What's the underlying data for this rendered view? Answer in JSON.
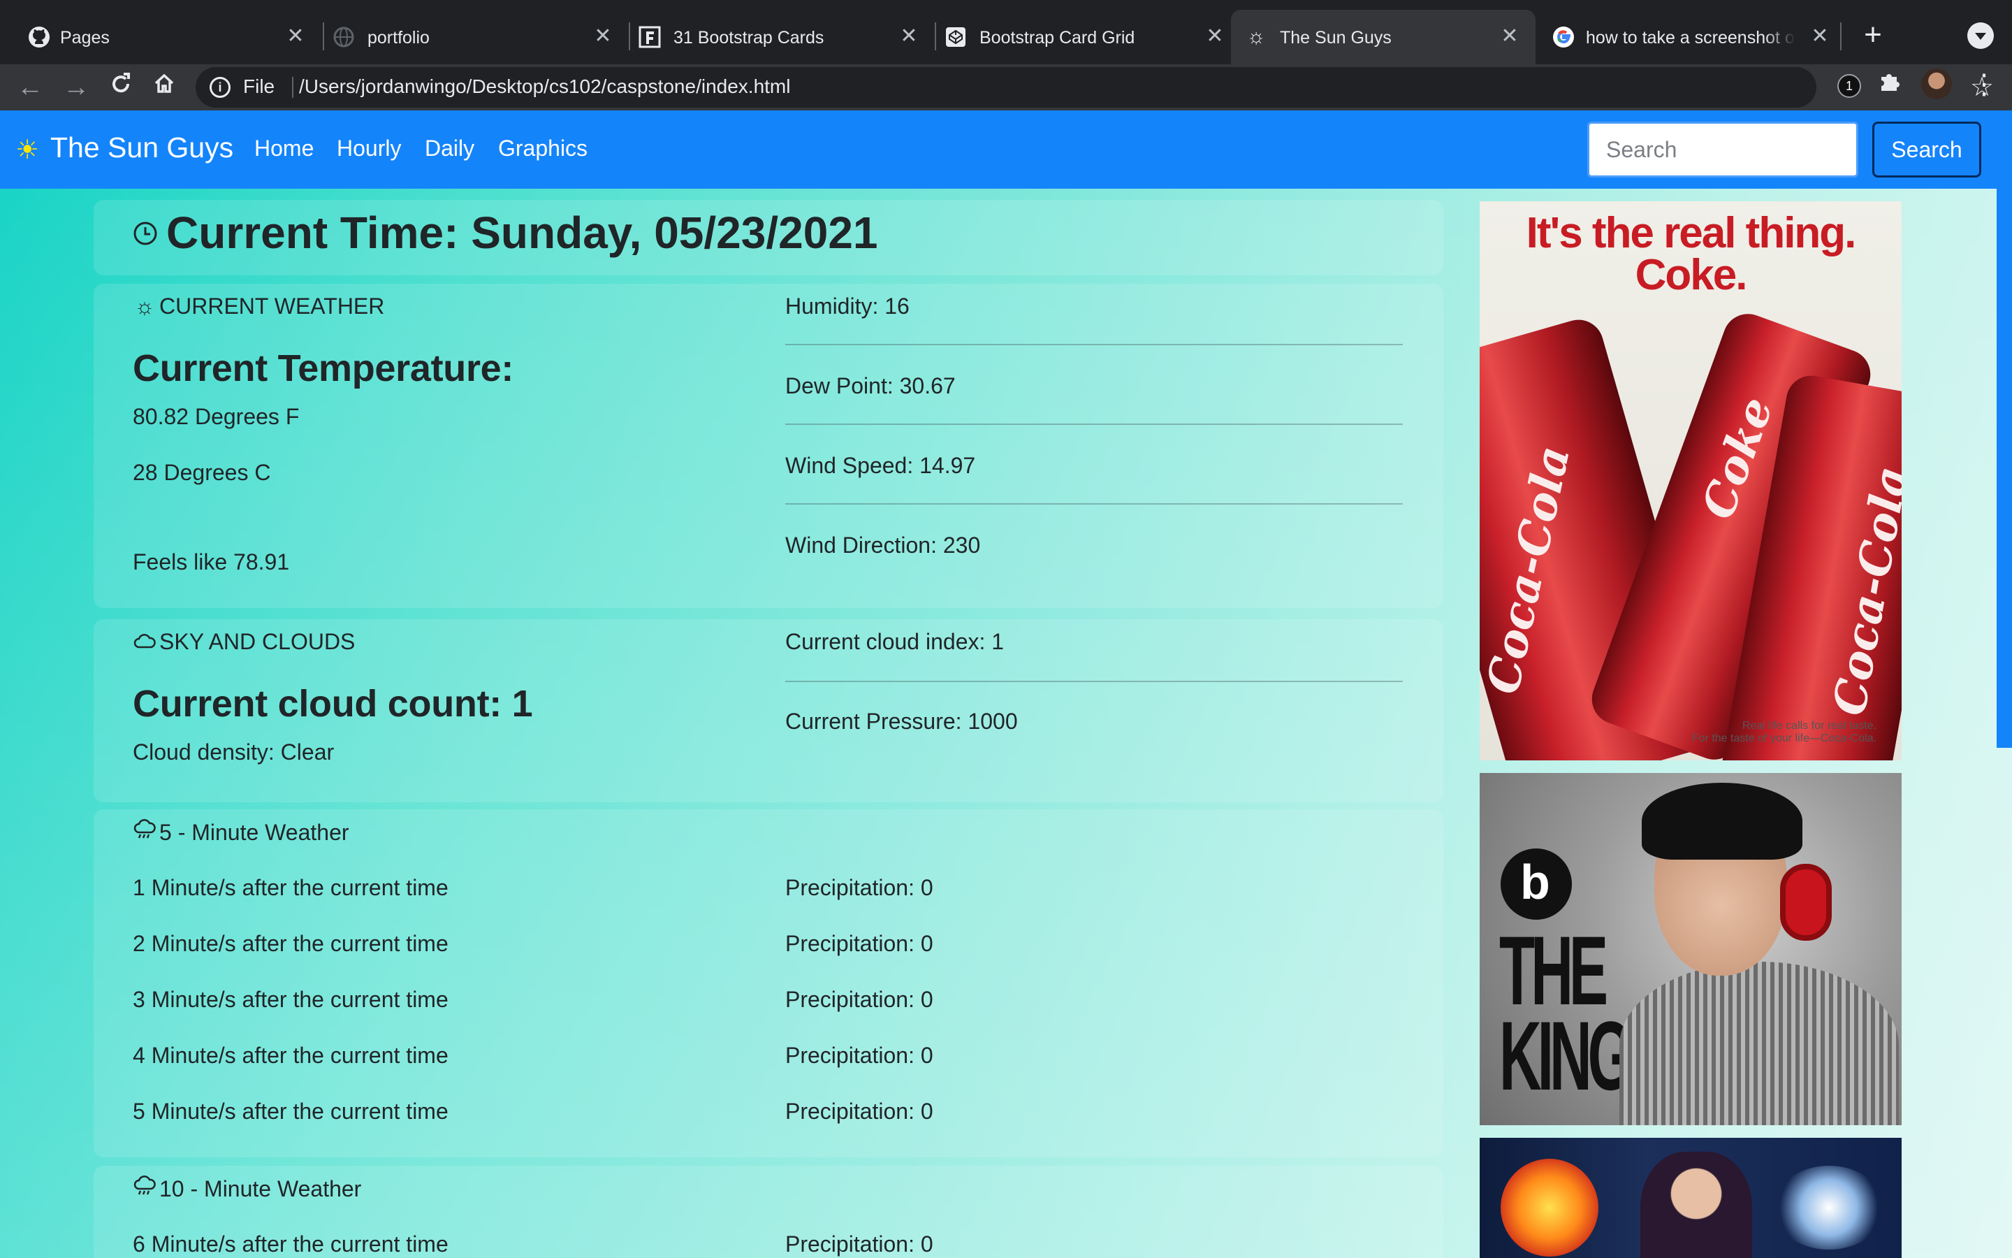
{
  "browser": {
    "tabs": [
      {
        "title": "Pages",
        "icon": "github-icon",
        "active": false
      },
      {
        "title": "portfolio",
        "icon": "globe-icon",
        "active": false
      },
      {
        "title": "31 Bootstrap Cards",
        "icon": "f-icon",
        "active": false
      },
      {
        "title": "Bootstrap Card Grid",
        "icon": "codepen-icon",
        "active": false
      },
      {
        "title": "The Sun Guys",
        "icon": "sun-icon",
        "active": true
      },
      {
        "title": "how to take a screenshot o",
        "icon": "google-icon",
        "active": false
      }
    ],
    "omnibox": {
      "scheme_label": "File",
      "url": "/Users/jordanwingo/Desktop/cs102/caspstone/index.html"
    },
    "extension_badge": "1"
  },
  "navbar": {
    "brand": "The Sun Guys",
    "links": [
      "Home",
      "Hourly",
      "Daily",
      "Graphics"
    ],
    "search_placeholder": "Search",
    "search_button": "Search",
    "colors": {
      "navbar": "#1484fb",
      "brand_icon": "#ffe500"
    }
  },
  "time_card": {
    "title": "Current Time: Sunday, 05/23/2021"
  },
  "weather_card": {
    "heading": "CURRENT WEATHER",
    "temp_heading": "Current Temperature:",
    "temp_f": "80.82 Degrees F",
    "temp_c": "28 Degrees C",
    "feels_like": "Feels like 78.91",
    "humidity": "Humidity: 16",
    "dew_point": "Dew Point: 30.67",
    "wind_speed": "Wind Speed: 14.97",
    "wind_direction": "Wind Direction: 230"
  },
  "sky_card": {
    "heading": "SKY AND CLOUDS",
    "cloud_count": "Current cloud count: 1",
    "cloud_density": "Cloud density: Clear",
    "cloud_index": "Current cloud index: 1",
    "pressure": "Current Pressure: 1000"
  },
  "minute5_card": {
    "heading": "5 - Minute Weather",
    "rows": [
      {
        "label": "1 Minute/s after the current time",
        "precip": "Precipitation: 0"
      },
      {
        "label": "2 Minute/s after the current time",
        "precip": "Precipitation: 0"
      },
      {
        "label": "3 Minute/s after the current time",
        "precip": "Precipitation: 0"
      },
      {
        "label": "4 Minute/s after the current time",
        "precip": "Precipitation: 0"
      },
      {
        "label": "5 Minute/s after the current time",
        "precip": "Precipitation: 0"
      }
    ]
  },
  "minute10_card": {
    "heading": "10 - Minute Weather",
    "rows": [
      {
        "label": "6 Minute/s after the current time",
        "precip": "Precipitation: 0"
      }
    ]
  },
  "ads": {
    "coke_headline_1": "It's the real thing.",
    "coke_headline_2": "Coke.",
    "coke_can_1": "Coca-Cola",
    "coke_can_2": "Coke",
    "coke_footer_1": "Real life calls for real taste.",
    "coke_footer_2": "For the taste of your life—Coca-Cola.",
    "king_text": "THE KING"
  }
}
